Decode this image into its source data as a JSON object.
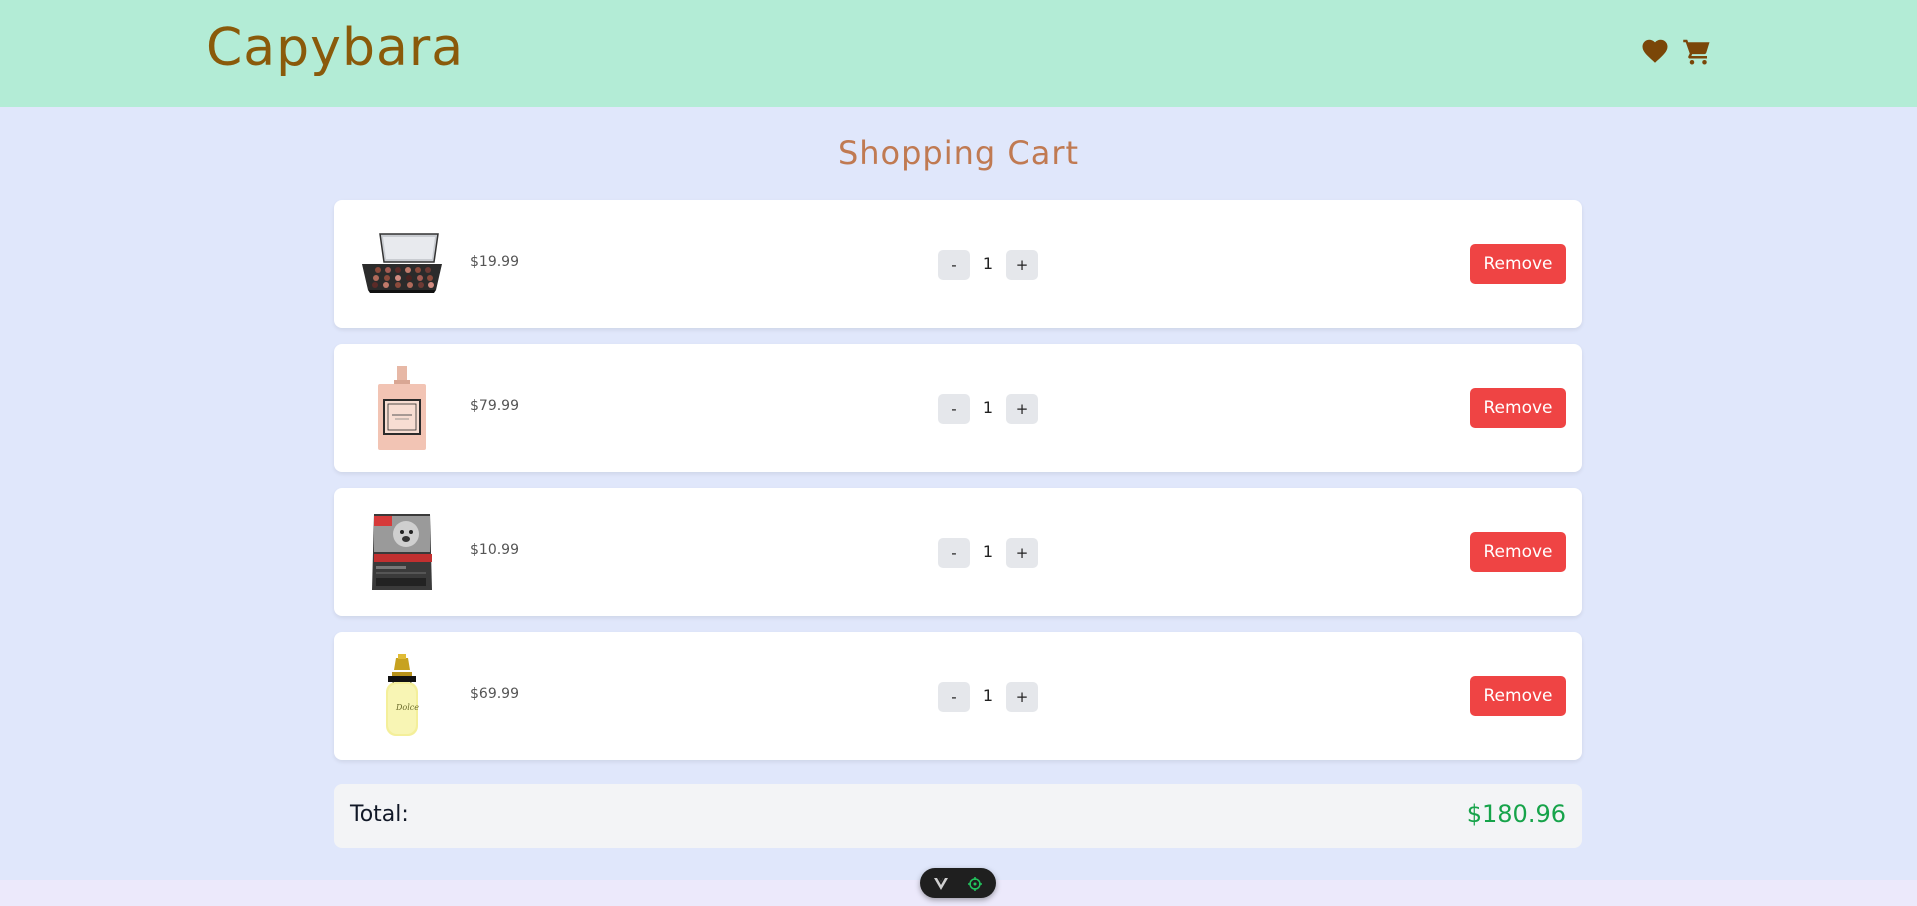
{
  "header": {
    "logo": "Capybara",
    "icons": [
      "heart-icon",
      "cart-icon"
    ],
    "color": "#7a4608"
  },
  "page_title": "Shopping Cart",
  "cart": {
    "items": [
      {
        "image": "eyeshadow-palette-image",
        "price": "$19.99",
        "quantity": "1",
        "minus": "-",
        "plus": "+",
        "remove_label": "Remove"
      },
      {
        "image": "perfume-bottle-pink-image",
        "price": "$79.99",
        "quantity": "1",
        "minus": "-",
        "plus": "+",
        "remove_label": "Remove"
      },
      {
        "image": "dog-food-bag-image",
        "price": "$10.99",
        "quantity": "1",
        "minus": "-",
        "plus": "+",
        "remove_label": "Remove"
      },
      {
        "image": "perfume-bottle-yellow-image",
        "price": "$69.99",
        "quantity": "1",
        "minus": "-",
        "plus": "+",
        "remove_label": "Remove"
      }
    ],
    "total_label": "Total:",
    "total_value": "$180.96"
  },
  "colors": {
    "header_bg": "#b3ecd6",
    "page_bg": "#e0e7fb",
    "logo": "#8a5a0a",
    "title": "#c07a52",
    "remove": "#ef4444",
    "total": "#16a34a"
  }
}
